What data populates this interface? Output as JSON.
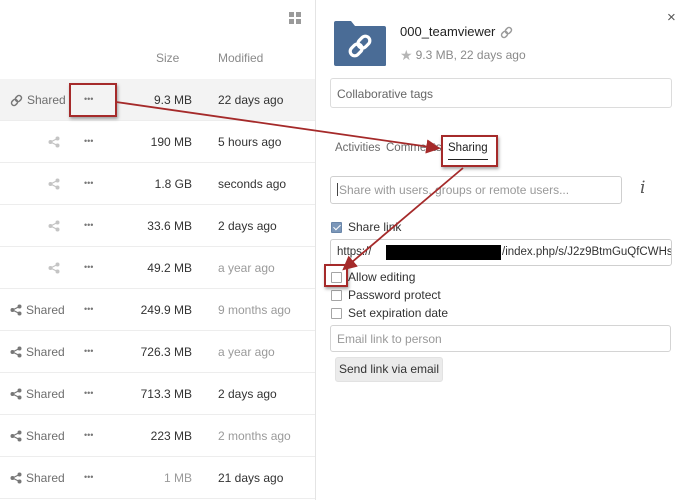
{
  "file_list": {
    "columns": {
      "size": "Size",
      "modified": "Modified"
    },
    "rows": [
      {
        "shared_label": "Shared",
        "share_icon": "link-icon",
        "size": "9.3 MB",
        "modified": "22 days ago"
      },
      {
        "shared_label": "",
        "share_icon": "share-icon",
        "size": "190 MB",
        "modified": "5 hours ago"
      },
      {
        "shared_label": "",
        "share_icon": "share-icon",
        "size": "1.8 GB",
        "modified": "seconds ago"
      },
      {
        "shared_label": "",
        "share_icon": "share-icon",
        "size": "33.6 MB",
        "modified": "2 days ago"
      },
      {
        "shared_label": "",
        "share_icon": "share-icon",
        "size": "49.2 MB",
        "modified": "a year ago"
      },
      {
        "shared_label": "Shared",
        "share_icon": "share-icon",
        "size": "249.9 MB",
        "modified": "9 months ago"
      },
      {
        "shared_label": "Shared",
        "share_icon": "share-icon",
        "size": "726.3 MB",
        "modified": "a year ago"
      },
      {
        "shared_label": "Shared",
        "share_icon": "share-icon",
        "size": "713.3 MB",
        "modified": "2 days ago"
      },
      {
        "shared_label": "Shared",
        "share_icon": "share-icon",
        "size": "223 MB",
        "modified": "2 months ago"
      },
      {
        "shared_label": "Shared",
        "share_icon": "share-icon",
        "size": "1 MB",
        "modified": "21 days ago"
      }
    ],
    "more_glyph": "•••"
  },
  "details": {
    "close_glyph": "×",
    "file_name": "000_teamviewer",
    "meta": "9.3 MB, 22 days ago",
    "star_glyph": "★",
    "tags_placeholder": "Collaborative tags",
    "tabs": {
      "activities": "Activities",
      "comments": "Comments",
      "sharing": "Sharing"
    },
    "share_input_placeholder": "Share with users, groups or remote users...",
    "info_glyph": "i",
    "share_link_label": "Share link",
    "share_link_checked": true,
    "link_prefix": "https://",
    "link_suffix": "/index.php/s/J2z9BtmGuQfCWHs",
    "allow_editing_label": "Allow editing",
    "password_protect_label": "Password protect",
    "expiration_label": "Set expiration date",
    "email_placeholder": "Email link to person",
    "send_email_label": "Send link via email"
  },
  "colors": {
    "folder_blue": "#4a6c96",
    "annotation_red": "#a52a2a",
    "checkbox_checked": "#7b97b9"
  }
}
